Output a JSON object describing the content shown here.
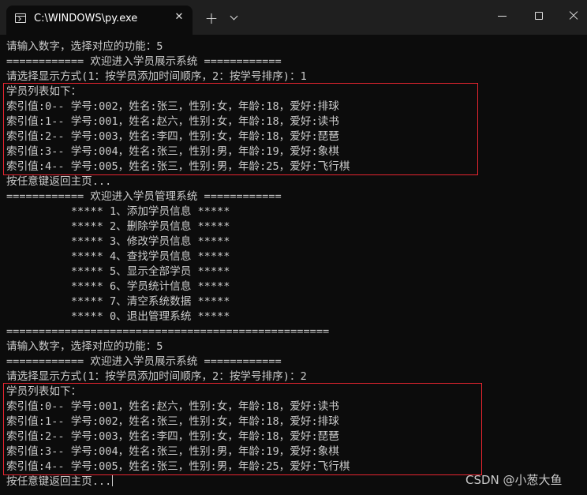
{
  "window": {
    "tab_title": "C:\\WINDOWS\\py.exe",
    "tab_close": "✕",
    "new_tab": "+"
  },
  "console": {
    "lines": [
      "请输入数字，选择对应的功能：5",
      "============ 欢迎进入学员展示系统 ============",
      "请选择显示方式(1：按学员添加时间顺序，2：按学号排序)：1",
      "学员列表如下：",
      "索引值:0-- 学号:002，姓名:张三，性别:女，年龄:18，爱好:排球",
      "索引值:1-- 学号:001，姓名:赵六，性别:女，年龄:18，爱好:读书",
      "索引值:2-- 学号:003，姓名:李四，性别:女，年龄:18，爱好:琵琶",
      "索引值:3-- 学号:004，姓名:张三，性别:男，年龄:19，爱好:象棋",
      "索引值:4-- 学号:005，姓名:张三，性别:男，年龄:25，爱好:飞行棋",
      "按任意键返回主页...",
      "============ 欢迎进入学员管理系统 ============",
      "          ***** 1、添加学员信息 *****",
      "          ***** 2、删除学员信息 *****",
      "          ***** 3、修改学员信息 *****",
      "          ***** 4、查找学员信息 *****",
      "          ***** 5、显示全部学员 *****",
      "          ***** 6、学员统计信息 *****",
      "          ***** 7、清空系统数据 *****",
      "          ***** 0、退出管理系统 *****",
      "==================================================",
      "请输入数字，选择对应的功能：5",
      "============ 欢迎进入学员展示系统 ============",
      "请选择显示方式(1：按学员添加时间顺序，2：按学号排序)：2",
      "学员列表如下：",
      "索引值:0-- 学号:001，姓名:赵六，性别:女，年龄:18，爱好:读书",
      "索引值:1-- 学号:002，姓名:张三，性别:女，年龄:18，爱好:排球",
      "索引值:2-- 学号:003，姓名:李四，性别:女，年龄:18，爱好:琵琶",
      "索引值:3-- 学号:004，姓名:张三，性别:男，年龄:19，爱好:象棋",
      "索引值:4-- 学号:005，姓名:张三，性别:男，年龄:25，爱好:飞行棋",
      "按任意键返回主页..."
    ]
  },
  "colors": {
    "console_bg": "#0c0c0c",
    "titlebar_bg": "#1f1f1f",
    "text": "#cccccc",
    "highlight_box": "#e8252f"
  },
  "watermark": "CSDN @小葱大鱼"
}
